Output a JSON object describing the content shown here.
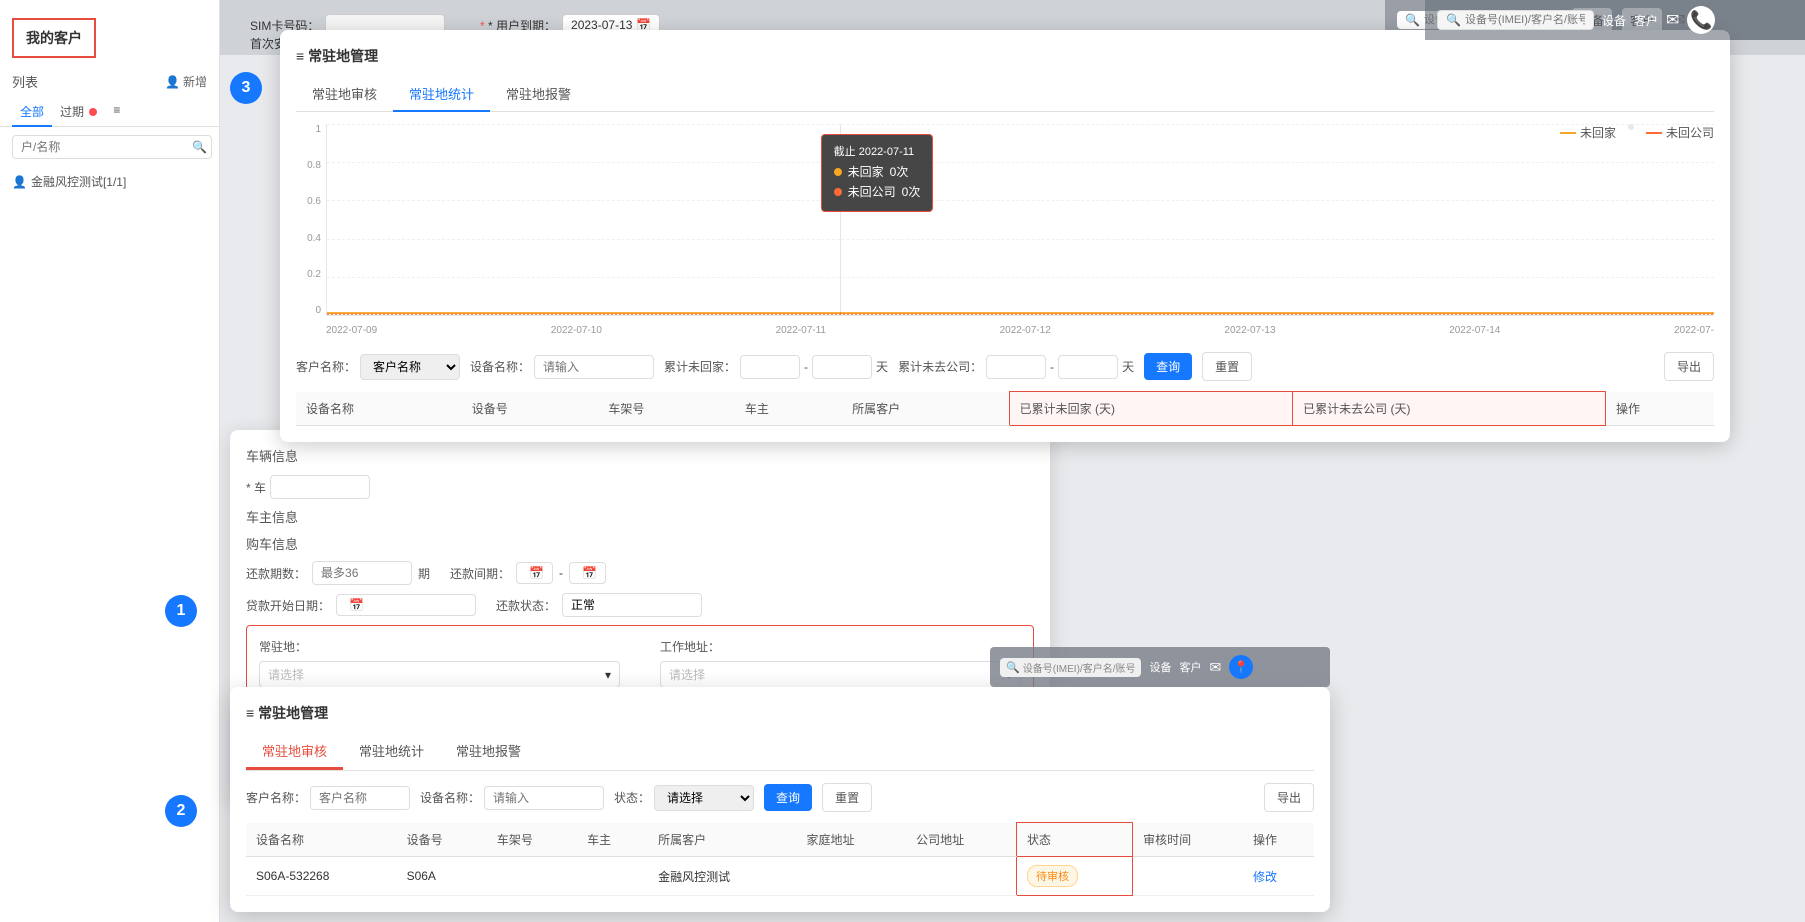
{
  "app": {
    "title": "我的客户"
  },
  "sidebar": {
    "title": "我的客户",
    "list_label": "列表",
    "new_btn": "新增",
    "tabs": [
      {
        "label": "全部",
        "active": true
      },
      {
        "label": "过期",
        "badge": true
      },
      {
        "label": "≡",
        "icon": true
      }
    ],
    "search_placeholder": "户/名称",
    "items": [
      {
        "label": "金融风控测试[1/1]",
        "icon": "👤"
      }
    ]
  },
  "top_bar": {
    "sim_label": "SIM卡号码：",
    "sim_placeholder": "",
    "user_expire_label": "* 用户到期：",
    "user_expire_value": "2023-07-13",
    "install_date_label": "首次安装日期："
  },
  "top_nav": {
    "device_btn": "设备",
    "customer_btn": "客户",
    "search_placeholder": "设备号(IMEI)/客户名/账号",
    "device_label": "设备",
    "customer_label": "客户"
  },
  "mgmt_dialog": {
    "title": "常驻地管理",
    "tabs": [
      {
        "label": "常驻地审核",
        "id": "audit"
      },
      {
        "label": "常驻地统计",
        "id": "stats",
        "active": true
      },
      {
        "label": "常驻地报警",
        "id": "alarm"
      }
    ]
  },
  "vehicle_info": {
    "section_label": "车辆信息",
    "car_no_label": "* 车",
    "owner_label": "车主信息"
  },
  "purchase_info": {
    "section_label": "购车信息"
  },
  "owner_info": {
    "section_label": "车主信息"
  },
  "loan_info": {
    "repay_period_label": "还款期数：",
    "repay_period_placeholder": "最多36",
    "repay_unit": "期",
    "repay_interval_label": "还款间期：",
    "loan_start_label": "贷款开始日期：",
    "repay_status_label": "还款状态：",
    "repay_status_value": "正常"
  },
  "address_section": {
    "home_label": "常驻地：",
    "home_placeholder": "请选择",
    "work_label": "工作地址：",
    "work_placeholder": "请选择"
  },
  "chart": {
    "y_labels": [
      "1",
      "0.8",
      "0.6",
      "0.4",
      "0.2",
      "0"
    ],
    "x_labels": [
      "2022-07-09",
      "2022-07-10",
      "2022-07-11",
      "2022-07-12",
      "2022-07-13",
      "2022-07-14",
      "2022-07-"
    ],
    "legend": [
      {
        "label": "未回家",
        "color": "#f5a623",
        "type": "line"
      },
      {
        "label": "未回公司",
        "color": "#ff6b35",
        "type": "line"
      }
    ],
    "tooltip": {
      "date": "截止 2022-07-11",
      "rows": [
        {
          "label": "未回家",
          "value": "0次",
          "color": "#f5a623"
        },
        {
          "label": "未回公司",
          "value": "0次",
          "color": "#ff6b35"
        }
      ]
    }
  },
  "stats_filter": {
    "customer_label": "客户名称：",
    "customer_placeholder": "客户名称",
    "device_label": "设备名称：",
    "device_placeholder": "请输入",
    "home_days_label": "累计未回家：",
    "range_sep": "-",
    "days_unit": "天",
    "company_days_label": "累计未去公司：",
    "query_btn": "查询",
    "reset_btn": "重置",
    "export_btn": "导出"
  },
  "stats_table": {
    "columns": [
      "设备名称",
      "设备号",
      "车架号",
      "车主",
      "所属客户",
      "已累计未回家 (天)",
      "已累计未去公司 (天)",
      "操作"
    ],
    "highlighted_cols": [
      "已累计未回家 (天)",
      "已累计未去公司 (天)"
    ]
  },
  "audit_section": {
    "title": "常驻地管理",
    "tabs": [
      {
        "label": "常驻地审核",
        "id": "audit",
        "active": true
      },
      {
        "label": "常驻地统计",
        "id": "stats"
      },
      {
        "label": "常驻地报警",
        "id": "alarm"
      }
    ],
    "filter": {
      "customer_label": "客户名称：",
      "customer_placeholder": "客户名称",
      "device_label": "设备名称：",
      "device_placeholder": "请输入",
      "status_label": "状态：",
      "status_placeholder": "请选择",
      "query_btn": "查询",
      "reset_btn": "重置",
      "export_btn": "导出"
    },
    "table": {
      "columns": [
        "设备名称",
        "设备号",
        "车架号",
        "车主",
        "所属客户",
        "家庭地址",
        "公司地址",
        "状态",
        "审核时间",
        "操作"
      ],
      "rows": [
        {
          "device_name": "S06A-532268",
          "device_no": "S06A",
          "frame_no": "",
          "owner": "",
          "customer": "金融风控测试",
          "home_addr": "",
          "company_addr": "",
          "status": "待审核",
          "audit_time": "",
          "action": "修改"
        }
      ]
    }
  },
  "badges": [
    {
      "number": "1",
      "label": "address section badge"
    },
    {
      "number": "2",
      "label": "audit card badge"
    },
    {
      "number": "3",
      "label": "stats card badge"
    }
  ]
}
